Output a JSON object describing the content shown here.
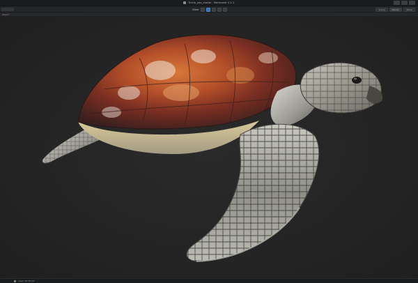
{
  "window": {
    "title": "Turtle_sea_model - Marmoset 4.1.2",
    "title_icon": "app-icon",
    "buttons": [
      {
        "icon": "minimize-icon",
        "color": "#3d3f43"
      },
      {
        "icon": "maximize-icon",
        "color": "#3d3f43"
      },
      {
        "icon": "close-icon",
        "color": "#3d3f43"
      }
    ]
  },
  "topright": {
    "buttons": [
      "Scene",
      "Render",
      "Share"
    ]
  },
  "toolbar": {
    "label": "Slider",
    "buttons": [
      {
        "icon": "move-icon",
        "active": false
      },
      {
        "icon": "camera-icon",
        "active": true
      },
      {
        "icon": "light-icon",
        "active": false
      },
      {
        "icon": "material-icon",
        "active": false
      },
      {
        "icon": "grid-icon",
        "active": false
      }
    ]
  },
  "subbar": {
    "label": "Object"
  },
  "status": {
    "text": "Layer 3D Model"
  },
  "colors": {
    "viewport_bg": "#232324",
    "accent": "#3e6fb0"
  }
}
